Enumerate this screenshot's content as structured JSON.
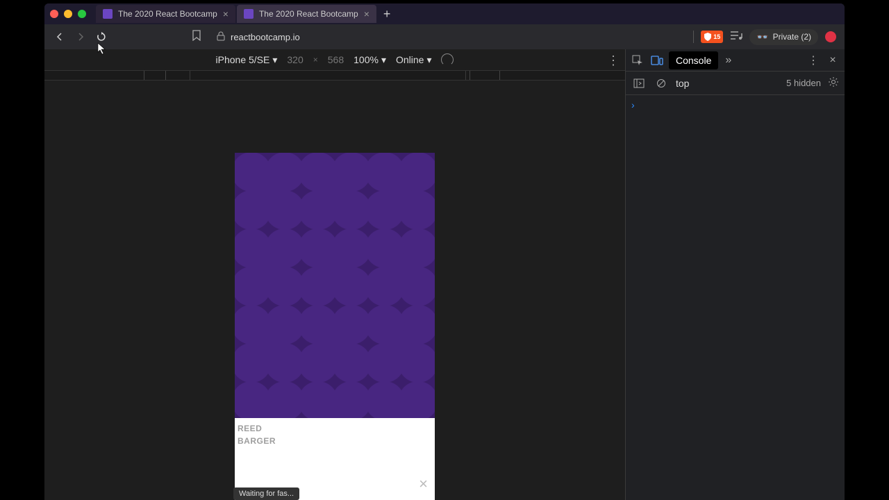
{
  "tabs": [
    {
      "title": "The 2020 React Bootcamp",
      "active": false
    },
    {
      "title": "The 2020 React Bootcamp",
      "active": true
    }
  ],
  "address": {
    "url": "reactbootcamp.io"
  },
  "shield": {
    "count": "15"
  },
  "private_badge": "Private (2)",
  "device_toolbar": {
    "device": "iPhone 5/SE",
    "width": "320",
    "height": "568",
    "zoom": "100%",
    "throttle": "Online"
  },
  "page": {
    "brand_line1": "REED",
    "brand_line2": "BARGER"
  },
  "status": "Waiting for fas...",
  "devtools": {
    "tab_console": "Console",
    "context": "top",
    "hidden": "5 hidden"
  }
}
